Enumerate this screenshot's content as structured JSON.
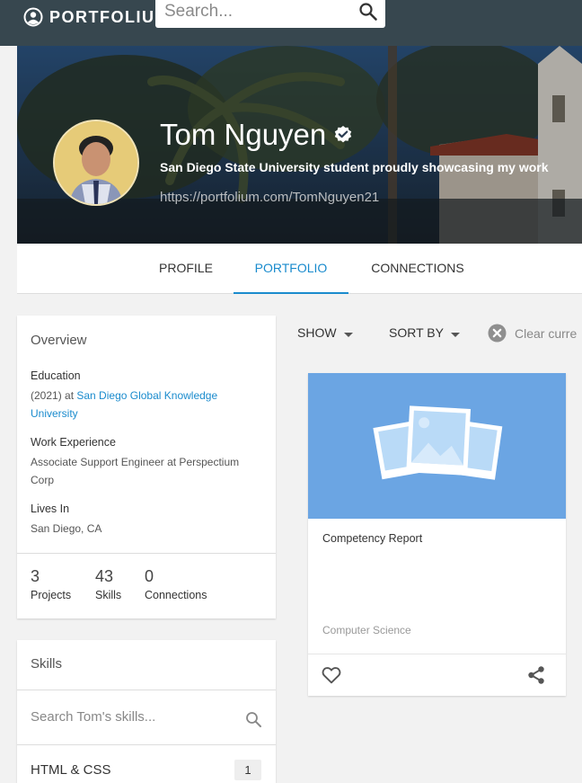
{
  "header": {
    "brand": "PORTFOLIUM",
    "search_placeholder": "Search..."
  },
  "profile": {
    "name": "Tom Nguyen",
    "tagline": "San Diego State University student proudly showcasing my work",
    "url": "https://portfolium.com/TomNguyen21"
  },
  "tabs": [
    {
      "label": "PROFILE",
      "active": false
    },
    {
      "label": "PORTFOLIO",
      "active": true
    },
    {
      "label": "CONNECTIONS",
      "active": false
    }
  ],
  "overview": {
    "title": "Overview",
    "education_label": "Education",
    "education_prefix": "(2021) at ",
    "education_school": "San Diego Global Knowledge University",
    "work_label": "Work Experience",
    "work_value": "Associate Support Engineer at Perspectium Corp",
    "lives_label": "Lives In",
    "lives_value": "San Diego, CA",
    "stats": [
      {
        "value": "3",
        "label": "Projects"
      },
      {
        "value": "43",
        "label": "Skills"
      },
      {
        "value": "0",
        "label": "Connections"
      }
    ]
  },
  "skills": {
    "title": "Skills",
    "search_placeholder": "Search Tom's skills...",
    "items": [
      {
        "name": "HTML & CSS",
        "count": "1"
      }
    ]
  },
  "filters": {
    "show_label": "SHOW",
    "sort_label": "SORT BY",
    "clear_label": "Clear curre"
  },
  "projects": [
    {
      "title": "Competency Report",
      "category": "Computer Science"
    }
  ],
  "colors": {
    "topbar": "#37474f",
    "accent": "#1a8bcd",
    "thumb": "#6ba5e3"
  }
}
